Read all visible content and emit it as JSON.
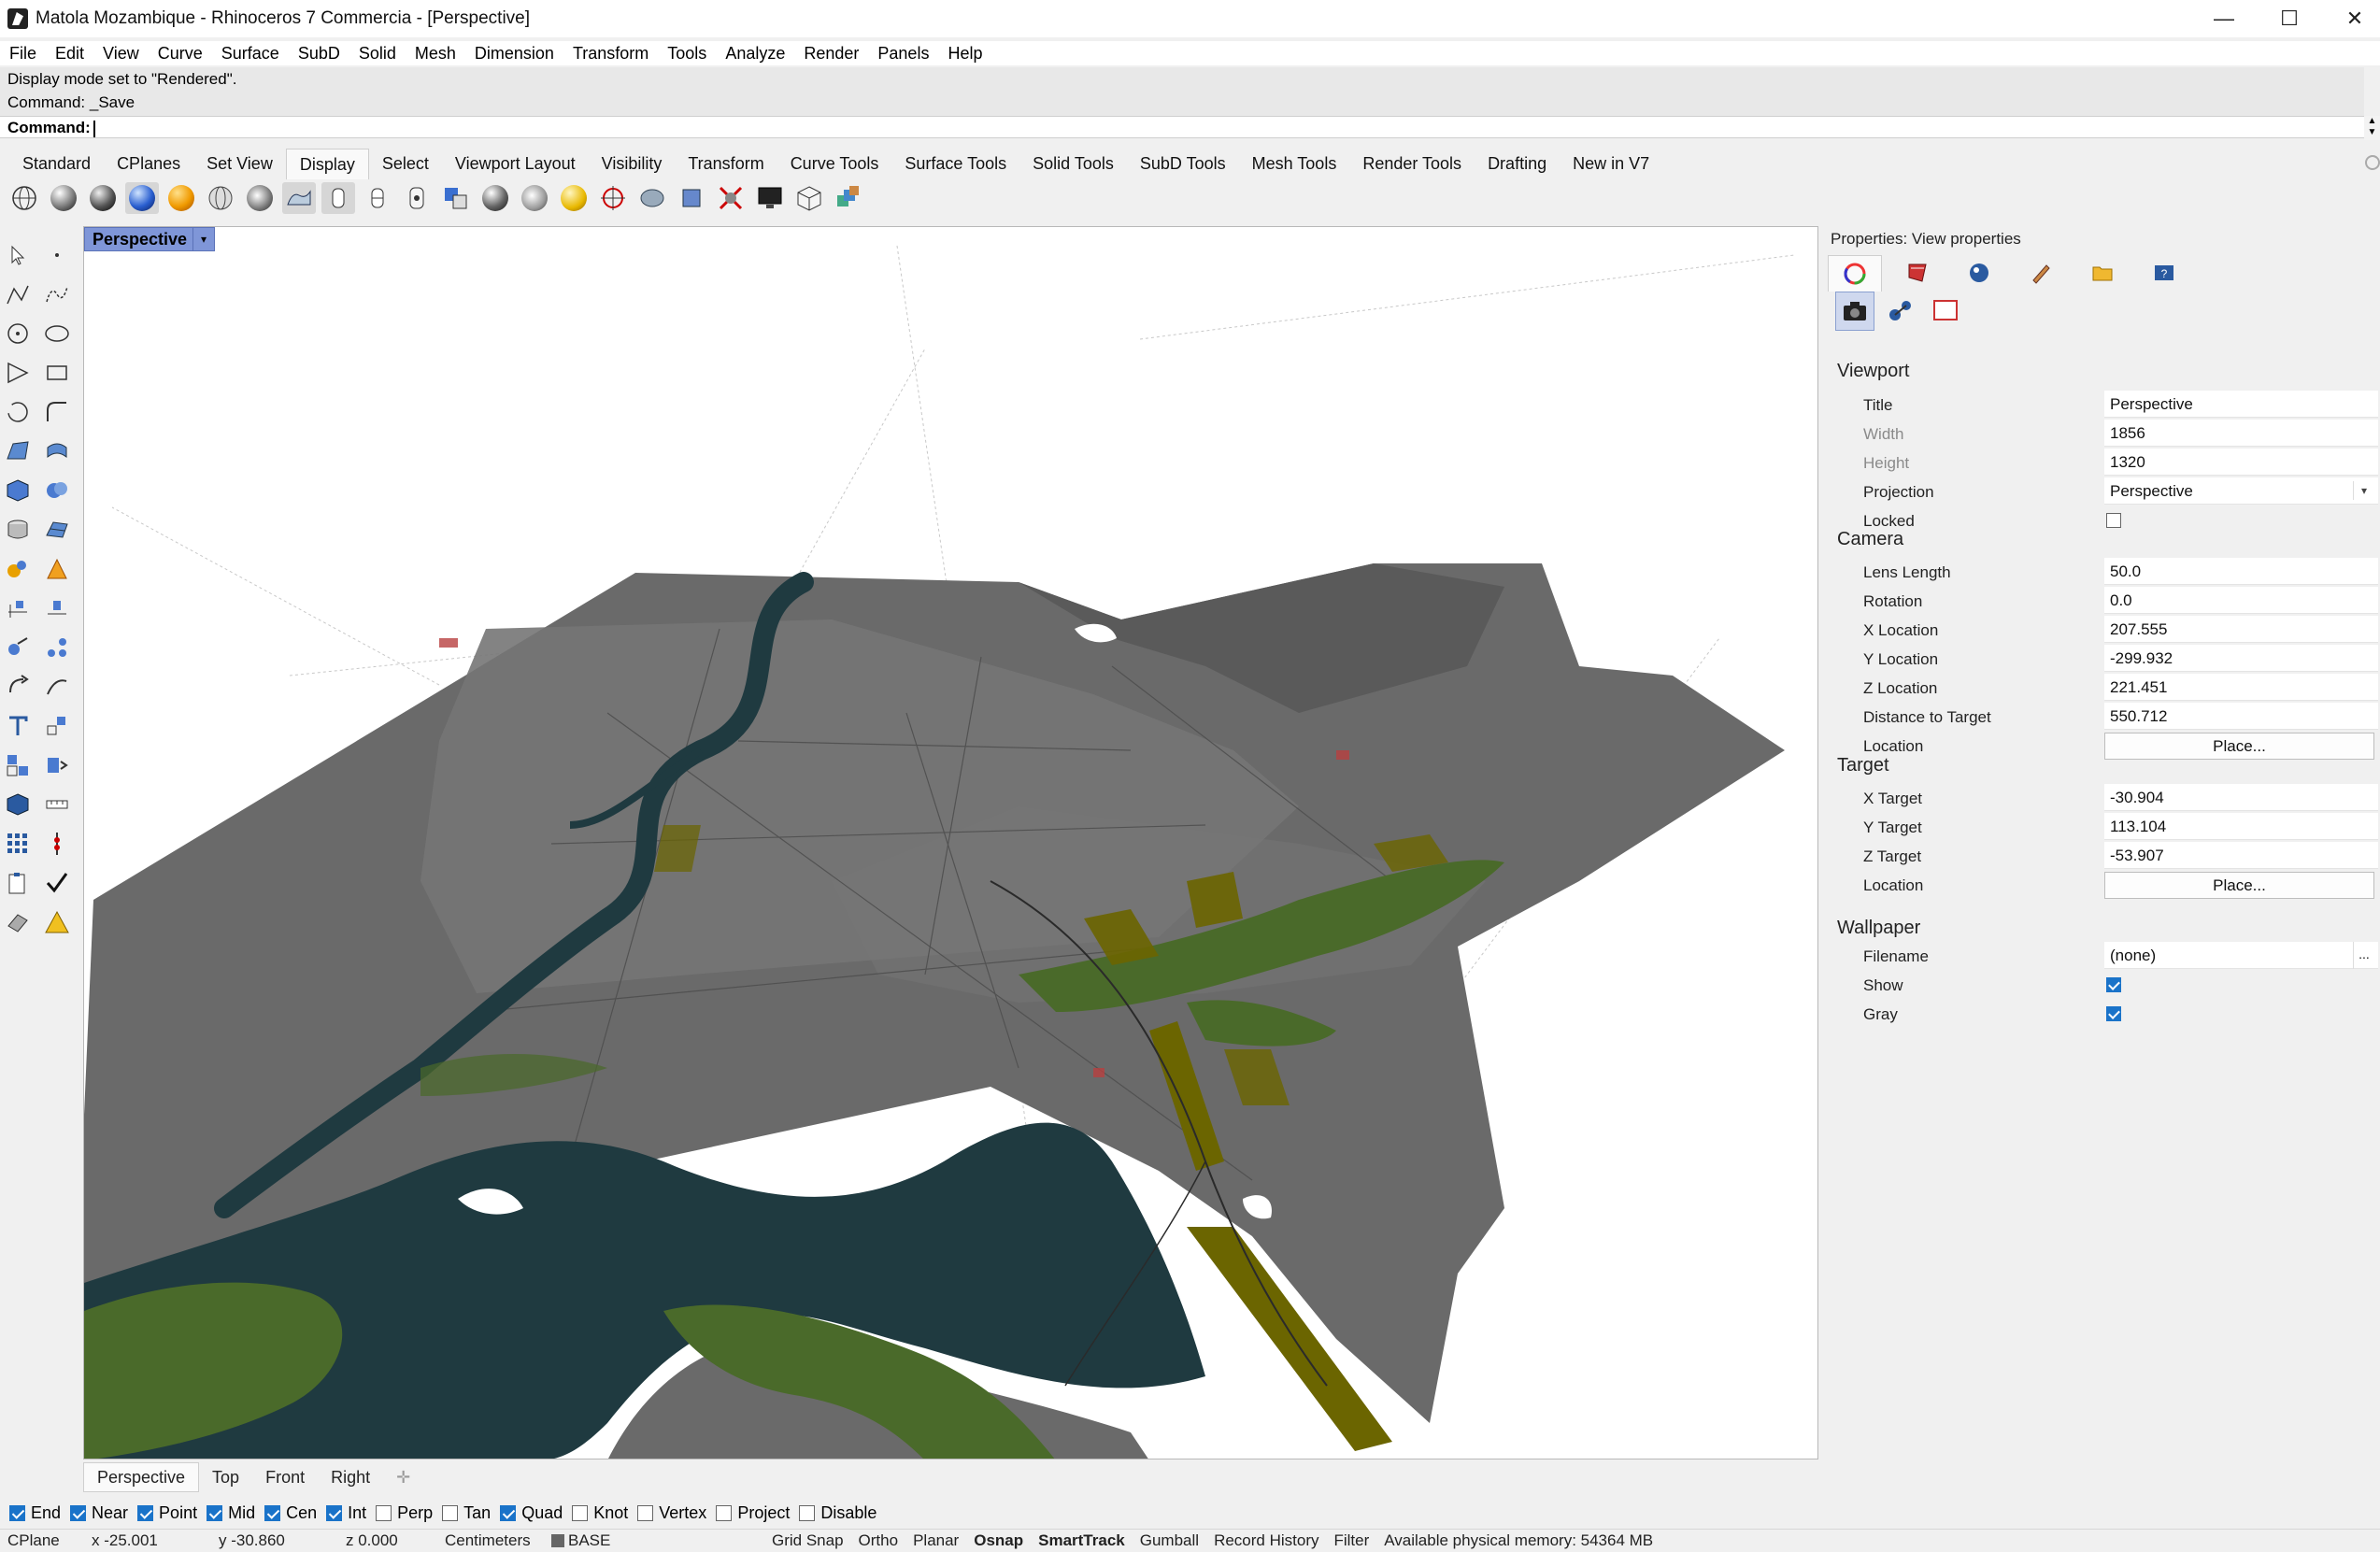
{
  "window": {
    "title": "Matola Mozambique - Rhinoceros 7 Commercia - [Perspective]",
    "min_glyph": "—",
    "max_glyph": "☐",
    "close_glyph": "✕"
  },
  "menu": [
    "File",
    "Edit",
    "View",
    "Curve",
    "Surface",
    "SubD",
    "Solid",
    "Mesh",
    "Dimension",
    "Transform",
    "Tools",
    "Analyze",
    "Render",
    "Panels",
    "Help"
  ],
  "command_history": [
    "Display mode set to \"Rendered\".",
    "Command: _Save"
  ],
  "command_prompt": "Command:",
  "toolbar_tabs": [
    "Standard",
    "CPlanes",
    "Set View",
    "Display",
    "Select",
    "Viewport Layout",
    "Visibility",
    "Transform",
    "Curve Tools",
    "Surface Tools",
    "Solid Tools",
    "SubD Tools",
    "Mesh Tools",
    "Render Tools",
    "Drafting",
    "New in V7"
  ],
  "active_toolbar_tab": "Display",
  "toolbar_icons": [
    "wireframe-icon",
    "shaded-icon",
    "rendered-icon",
    "ghosted-icon",
    "xray-icon",
    "technical-icon",
    "artistic-icon",
    "pen-icon",
    "arctic-icon",
    "raytraced-icon",
    "monochrome-icon",
    "display-options-icon",
    "lights-icon",
    "sun-icon",
    "clipping-plane-icon",
    "section-icon",
    "zebra-icon",
    "draft-angle-icon",
    "screen-icon",
    "cube-icon",
    "layers-icon"
  ],
  "viewport": {
    "label": "Perspective",
    "tabs": [
      "Perspective",
      "Top",
      "Front",
      "Right"
    ],
    "add_glyph": "✛",
    "drop_glyph": "▾"
  },
  "properties": {
    "title": "Properties: View properties",
    "viewport_section": "Viewport",
    "camera_section": "Camera",
    "target_section": "Target",
    "wallpaper_section": "Wallpaper",
    "viewport": {
      "title_label": "Title",
      "title_value": "Perspective",
      "width_label": "Width",
      "width_value": "1856",
      "height_label": "Height",
      "height_value": "1320",
      "projection_label": "Projection",
      "projection_value": "Perspective",
      "locked_label": "Locked",
      "locked": false
    },
    "camera": {
      "lens_label": "Lens Length",
      "lens_value": "50.0",
      "rotation_label": "Rotation",
      "rotation_value": "0.0",
      "x_label": "X Location",
      "x_value": "207.555",
      "y_label": "Y Location",
      "y_value": "-299.932",
      "z_label": "Z Location",
      "z_value": "221.451",
      "dist_label": "Distance to Target",
      "dist_value": "550.712",
      "location_label": "Location",
      "location_button": "Place..."
    },
    "target": {
      "x_label": "X Target",
      "x_value": "-30.904",
      "y_label": "Y Target",
      "y_value": "113.104",
      "z_label": "Z Target",
      "z_value": "-53.907",
      "location_label": "Location",
      "location_button": "Place..."
    },
    "wallpaper": {
      "filename_label": "Filename",
      "filename_value": "(none)",
      "browse_glyph": "...",
      "show_label": "Show",
      "show": true,
      "gray_label": "Gray",
      "gray": true
    }
  },
  "osnaps": [
    {
      "label": "End",
      "on": true
    },
    {
      "label": "Near",
      "on": true
    },
    {
      "label": "Point",
      "on": true
    },
    {
      "label": "Mid",
      "on": true
    },
    {
      "label": "Cen",
      "on": true
    },
    {
      "label": "Int",
      "on": true
    },
    {
      "label": "Perp",
      "on": false
    },
    {
      "label": "Tan",
      "on": false
    },
    {
      "label": "Quad",
      "on": true
    },
    {
      "label": "Knot",
      "on": false
    },
    {
      "label": "Vertex",
      "on": false
    },
    {
      "label": "Project",
      "on": false
    },
    {
      "label": "Disable",
      "on": false
    }
  ],
  "status": {
    "cplane": "CPlane",
    "x": "x -25.001",
    "y": "y -30.860",
    "z": "z 0.000",
    "units": "Centimeters",
    "layer": "BASE",
    "grid_snap": "Grid Snap",
    "ortho": "Ortho",
    "planar": "Planar",
    "osnap": "Osnap",
    "smarttrack": "SmartTrack",
    "gumball": "Gumball",
    "record_history": "Record History",
    "filter": "Filter",
    "memory": "Available physical memory: 54364 MB"
  },
  "colors": {
    "viewport_label_bg": "#7f96d8",
    "checkbox_accent": "#1a73c9",
    "water": "#1f3a40",
    "vegetation": "#4a6a2a",
    "land": "#6a6a6a"
  }
}
